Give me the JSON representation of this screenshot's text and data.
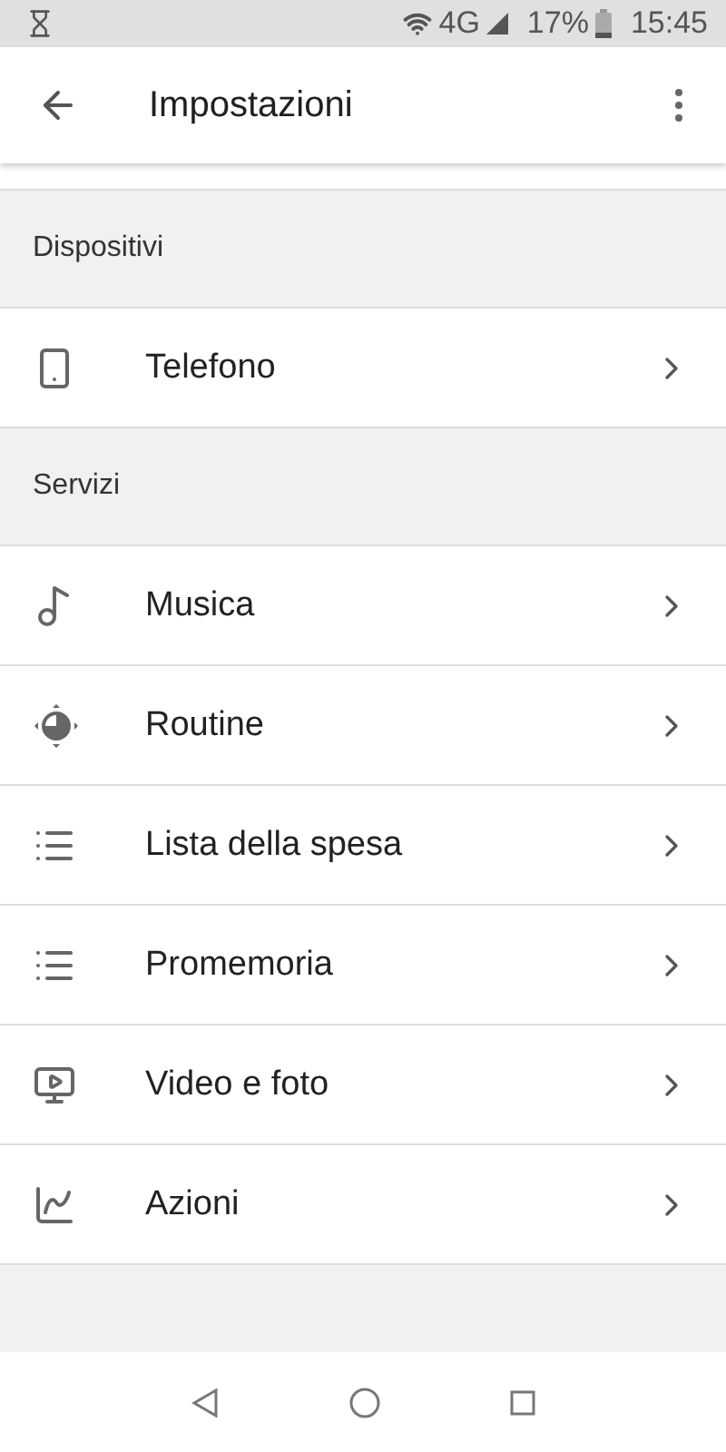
{
  "status_bar": {
    "network": "4G",
    "battery": "17%",
    "time": "15:45"
  },
  "app_bar": {
    "title": "Impostazioni"
  },
  "sections": [
    {
      "title": "Dispositivi",
      "items": [
        {
          "label": "Telefono",
          "kind": "phone"
        }
      ]
    },
    {
      "title": "Servizi",
      "items": [
        {
          "label": "Musica",
          "kind": "music"
        },
        {
          "label": "Routine",
          "kind": "routine"
        },
        {
          "label": "Lista della spesa",
          "kind": "list"
        },
        {
          "label": "Promemoria",
          "kind": "list"
        },
        {
          "label": "Video e foto",
          "kind": "video"
        },
        {
          "label": "Azioni",
          "kind": "chart"
        }
      ]
    }
  ]
}
